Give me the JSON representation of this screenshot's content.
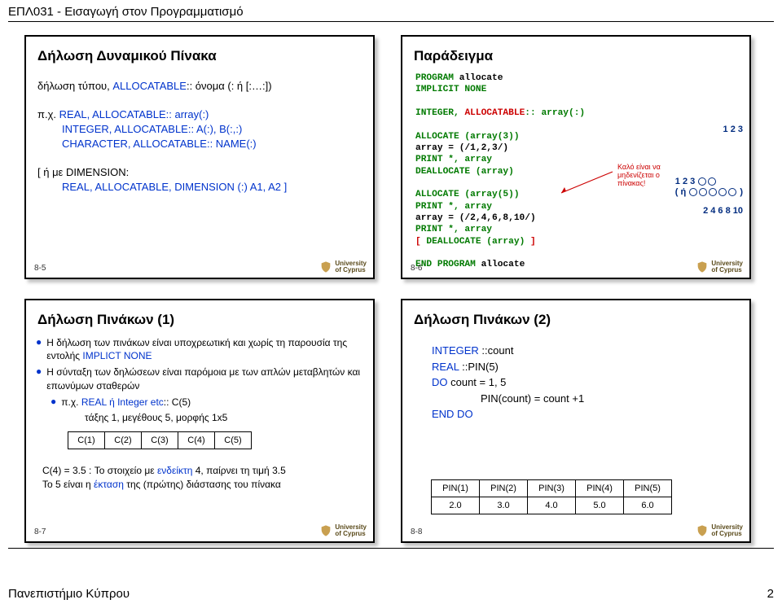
{
  "header": {
    "course": "EΠΛ031 - Εισαγωγή στον Προγραμματισμό"
  },
  "footer": {
    "left": "Πανεπιστήμιο Κύπρου",
    "right": "2"
  },
  "logo": {
    "l1": "University",
    "l2": "of Cyprus"
  },
  "s5": {
    "num": "8-5",
    "title": "Δήλωση Δυναμικού Πίνακα",
    "decl": "δήλωση τύπου, ",
    "allocatable": "ALLOCATABLE",
    "name_suffix": ":: όνομα (: ή [:…:])",
    "eg": "π.χ. ",
    "l1": "REAL, ALLOCATABLE:: array(:)",
    "l2": "INTEGER, ALLOCATABLE:: A(:), B(:,:)",
    "l3": "CHARACTER, ALLOCATABLE:: NAME(:)",
    "dimlabel": "[ ή με DIMENSION:",
    "dim": "REAL, ALLOCATABLE, DIMENSION (:) A1, A2 ]"
  },
  "s6": {
    "num": "8-6",
    "title": "Παράδειγμα",
    "code_l1": "PROGRAM ",
    "code_l1b": "allocate",
    "code_l2": "IMPLICIT NONE",
    "code_l3a": "INTEGER, ",
    "code_l3b": "ALLOCATABLE",
    "code_l3c": ":: array(:)",
    "code_l4": "ALLOCATE (array(3))",
    "code_l5": "array = (/1,2,3/)",
    "code_l6": "PRINT *, array",
    "code_l7": "DEALLOCATE (array)",
    "code_l8": "ALLOCATE (array(5))",
    "code_l9": "PRINT *, array",
    "code_l10": "array = (/2,4,6,8,10/)",
    "code_l11": "PRINT *, array",
    "code_l12a": "[",
    "code_l12b": " DEALLOCATE (array) ",
    "code_l12c": "]",
    "code_l13a": "END PROGRAM ",
    "code_l13b": "allocate",
    "out1": "1 2 3",
    "out2a": "1 2 3 ",
    "out2b": "( ή ",
    "out2c": " )",
    "out3": "2 4 6 8 10",
    "callout": "Καλό είναι να μηδενίζεται ο πίνακας!"
  },
  "s7": {
    "num": "8-7",
    "title": "Δήλωση Πινάκων (1)",
    "b1": "Η δήλωση των πινάκων είναι υποχρεωτική και χωρίς τη παρουσία της εντολής ",
    "b1b": "IMPLICT NONE",
    "b2": "Η σύνταξη των δηλώσεων είναι παρόμοια με των απλών μεταβλητών και επωνύμων σταθερών",
    "b3a": "π.χ. ",
    "b3b": "REAL ή Integer etc",
    "b3c": ":: C(5)",
    "b4": "τάξης 1, μεγέθους 5, μορφής 1x5",
    "cells": [
      "C(1)",
      "C(2)",
      "C(3)",
      "C(4)",
      "C(5)"
    ],
    "n1a": "C(4) = 3.5 : Το στοιχείο με ",
    "n1b": "ενδείκτη",
    "n1c": " 4, παίρνει τη τιμή 3.5",
    "n2a": "Το 5 είναι η ",
    "n2b": "έκταση",
    "n2c": " της (πρώτης) διάστασης του πίνακα"
  },
  "s8": {
    "num": "8-8",
    "title": "Δήλωση Πινάκων (2)",
    "l1a": "INTEGER ",
    "l1b": "::count",
    "l2a": "REAL ",
    "l2b": "::PIN(5)",
    "l3a": "DO",
    "l3b": " count = 1, 5",
    "l4": "PIN(count) = count +1",
    "l5": "END DO",
    "headers": [
      "PIN(1)",
      "PIN(2)",
      "PIN(3)",
      "PIN(4)",
      "PIN(5)"
    ],
    "values": [
      "2.0",
      "3.0",
      "4.0",
      "5.0",
      "6.0"
    ]
  }
}
